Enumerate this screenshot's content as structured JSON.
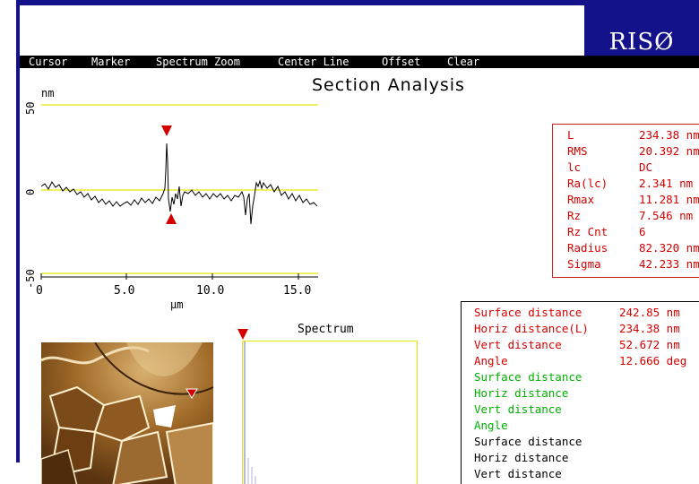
{
  "logo": "RISØ",
  "menu": [
    "Cursor",
    "Marker",
    "Spectrum Zoom",
    "Center Line",
    "Offset",
    "Clear"
  ],
  "title": "Section Analysis",
  "plot": {
    "y_unit": "nm",
    "x_unit": "µm",
    "y_ticks": [
      "50",
      "0",
      "-50"
    ],
    "x_ticks": [
      "0",
      "5.0",
      "10.0",
      "15.0"
    ]
  },
  "stats": [
    {
      "label": "L",
      "value": "234.38 nm"
    },
    {
      "label": "RMS",
      "value": "20.392 nm"
    },
    {
      "label": "lc",
      "value": "DC"
    },
    {
      "label": "Ra(lc)",
      "value": "2.341 nm"
    },
    {
      "label": "Rmax",
      "value": "11.281 nm"
    },
    {
      "label": "Rz",
      "value": "7.546 nm"
    },
    {
      "label": "Rz Cnt",
      "value": "6"
    },
    {
      "label": "Radius",
      "value": "82.320 nm"
    },
    {
      "label": "Sigma",
      "value": "42.233 nm"
    }
  ],
  "measurements": [
    {
      "label": "Surface distance",
      "value": "242.85 nm",
      "color": "#d40000"
    },
    {
      "label": "Horiz distance(L)",
      "value": "234.38 nm",
      "color": "#d40000"
    },
    {
      "label": "Vert distance",
      "value": "52.672 nm",
      "color": "#d40000"
    },
    {
      "label": "Angle",
      "value": "12.666 deg",
      "color": "#d40000"
    },
    {
      "label": "Surface distance",
      "value": "",
      "color": "#00b000"
    },
    {
      "label": "Horiz distance",
      "value": "",
      "color": "#00b000"
    },
    {
      "label": "Vert distance",
      "value": "",
      "color": "#00b000"
    },
    {
      "label": "Angle",
      "value": "",
      "color": "#00b000"
    },
    {
      "label": "Surface distance",
      "value": "",
      "color": "#000000"
    },
    {
      "label": "Horiz distance",
      "value": "",
      "color": "#000000"
    },
    {
      "label": "Vert distance",
      "value": "",
      "color": "#000000"
    }
  ],
  "spectrum_title": "Spectrum",
  "colors": {
    "accent_blue": "#14128a",
    "marker_red": "#d40000",
    "guide_yellow": "#e8e800"
  }
}
